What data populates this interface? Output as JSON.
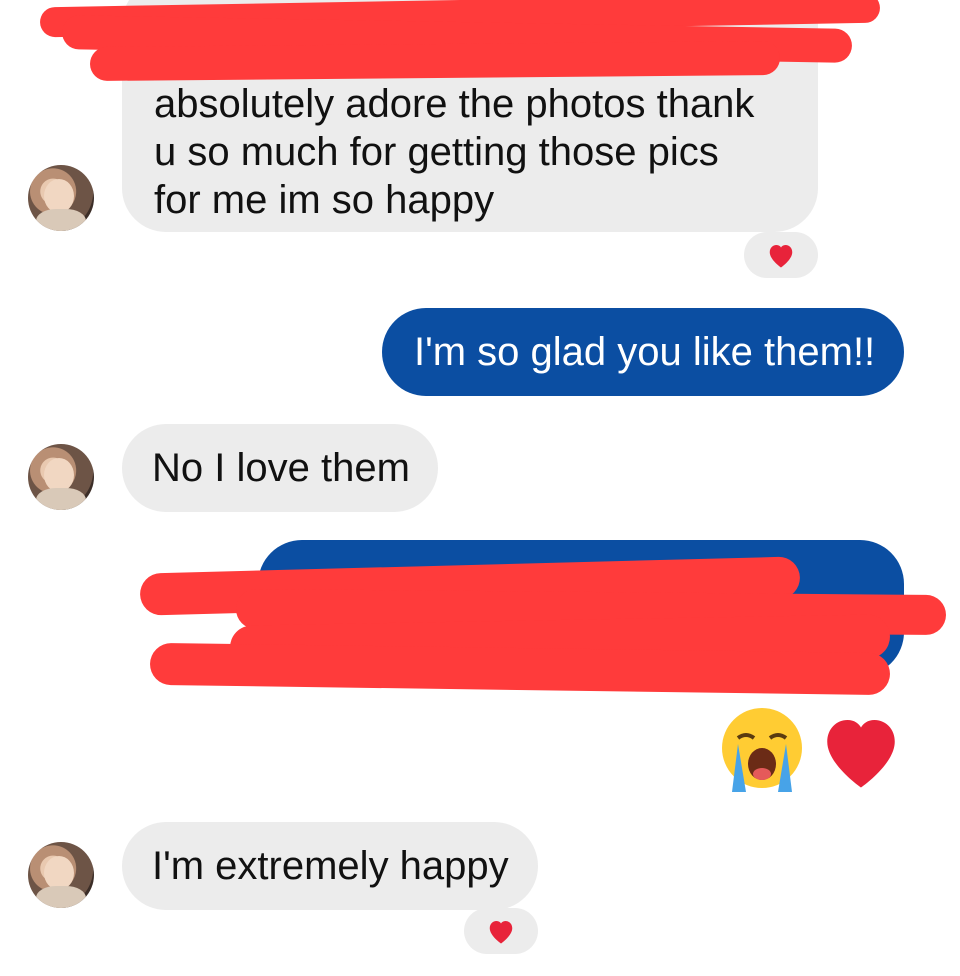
{
  "messages": {
    "m1": {
      "text": "absolutely adore the photos thank u so much for getting those pics for me im so happy",
      "line1": "absolutely adore the photos thank",
      "line2": "u so much for getting those pics",
      "line3": "for me im so happy"
    },
    "m2": {
      "text": "I'm so glad you like them!!"
    },
    "m3": {
      "text": "No I love them"
    },
    "m5": {
      "text": "I'm extremely happy"
    }
  },
  "reactions": {
    "r1": "heart-icon",
    "r2": "heart-icon"
  },
  "emoji_message": {
    "items": [
      "loudly-crying-face-icon",
      "red-heart-icon"
    ]
  },
  "colors": {
    "incoming_bubble": "#ececec",
    "outgoing_bubble": "#0b4ea2",
    "redaction": "#ff3b3b",
    "heart": "#e8233a"
  }
}
